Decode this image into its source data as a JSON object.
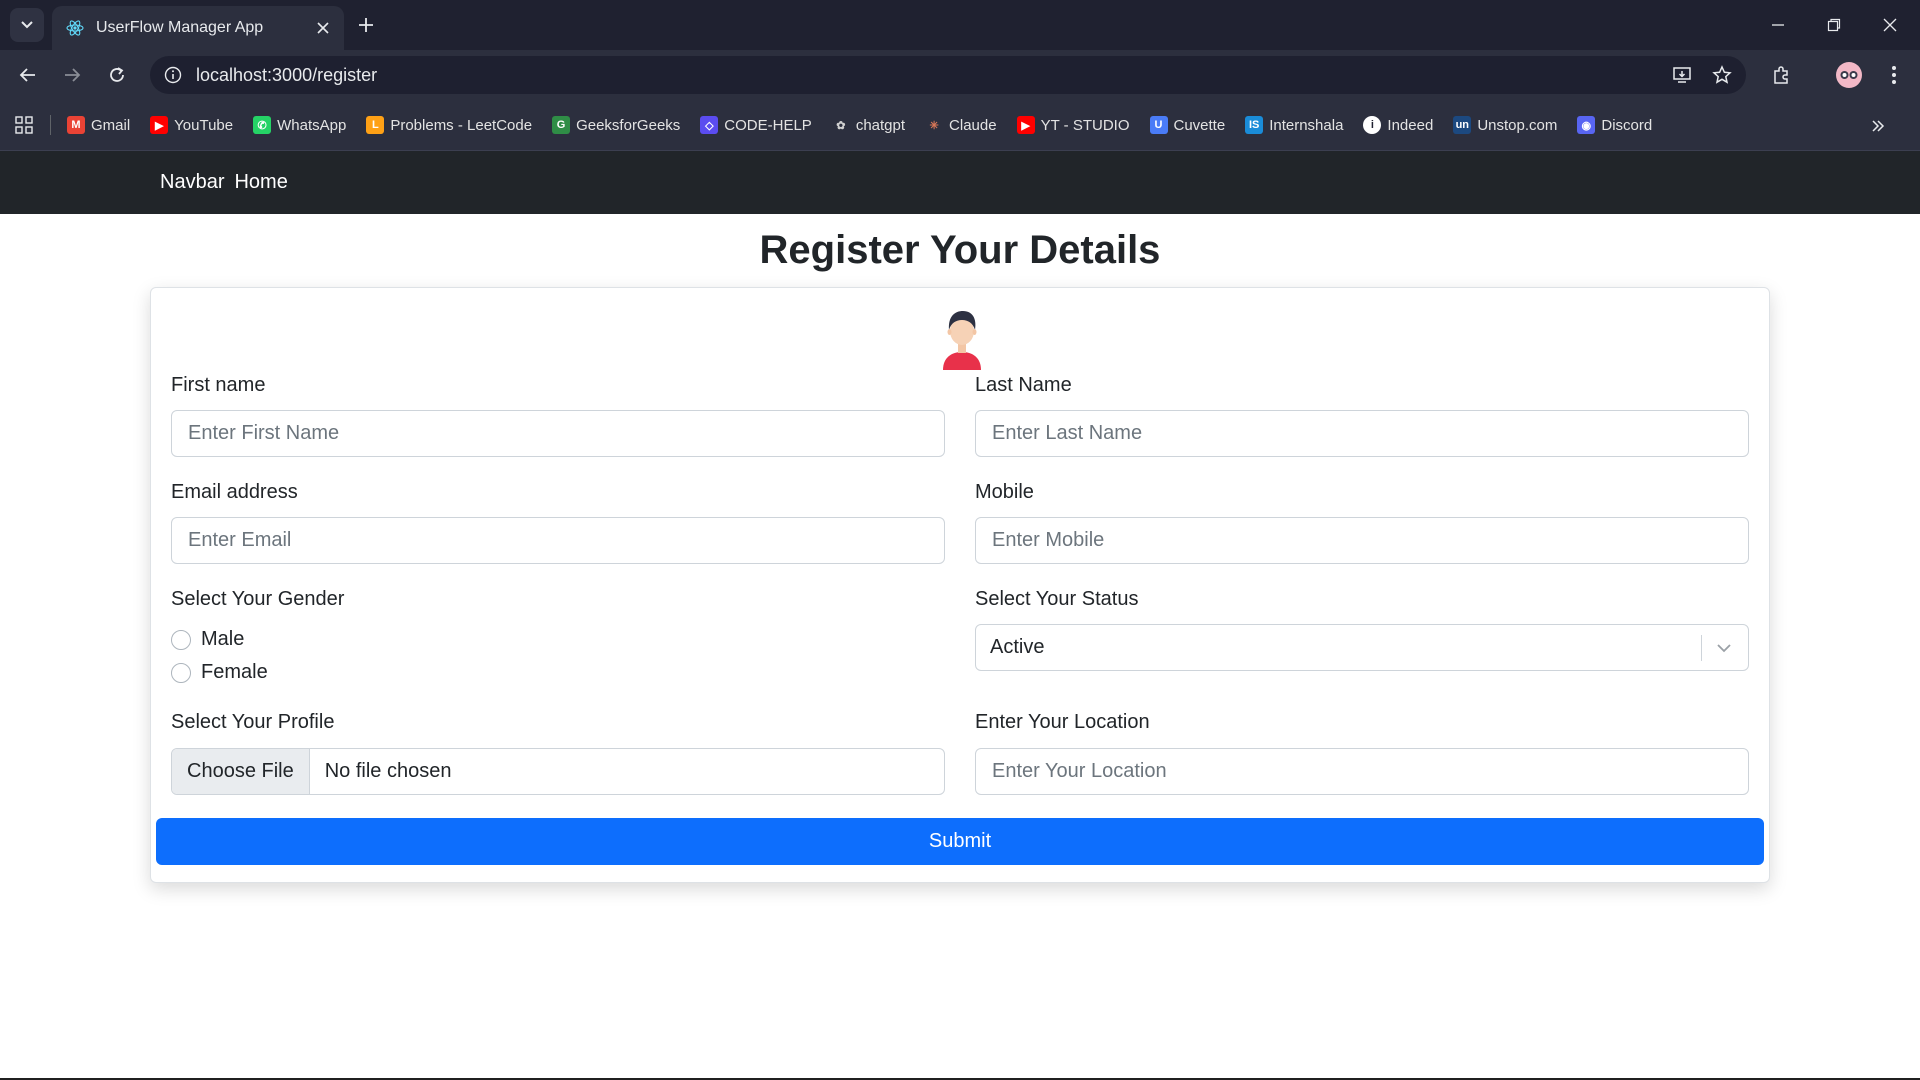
{
  "browser": {
    "tab": {
      "title": "UserFlow Manager App"
    },
    "address": {
      "url": "localhost:3000/register"
    },
    "bookmarks": [
      {
        "label": "Gmail",
        "icon": "gmail-icon",
        "color": "#ea4335"
      },
      {
        "label": "YouTube",
        "icon": "youtube-icon",
        "color": "#ff0000"
      },
      {
        "label": "WhatsApp",
        "icon": "whatsapp-icon",
        "color": "#25d366"
      },
      {
        "label": "Problems - LeetCode",
        "icon": "leetcode-icon",
        "color": "#ffa116"
      },
      {
        "label": "GeeksforGeeks",
        "icon": "geeksforgeeks-icon",
        "color": "#2f8d46"
      },
      {
        "label": "CODE-HELP",
        "icon": "codehelp-icon",
        "color": "#5b4cf0"
      },
      {
        "label": "chatgpt",
        "icon": "chatgpt-icon",
        "color": "#d0d0d0"
      },
      {
        "label": "Claude",
        "icon": "claude-icon",
        "color": "#d97757"
      },
      {
        "label": "YT - STUDIO",
        "icon": "yt-studio-icon",
        "color": "#ff0000"
      },
      {
        "label": "Cuvette",
        "icon": "cuvette-icon",
        "color": "#4a7cf7"
      },
      {
        "label": "Internshala",
        "icon": "internshala-icon",
        "color": "#1a8cd8"
      },
      {
        "label": "Indeed",
        "icon": "indeed-icon",
        "color": "#ffffff"
      },
      {
        "label": "Unstop.com",
        "icon": "unstop-icon",
        "color": "#1c4980"
      },
      {
        "label": "Discord",
        "icon": "discord-icon",
        "color": "#5865f2"
      }
    ]
  },
  "navbar": {
    "brand": "Navbar",
    "home": "Home"
  },
  "form": {
    "title": "Register Your Details",
    "first_name": {
      "label": "First name",
      "placeholder": "Enter First Name"
    },
    "last_name": {
      "label": "Last Name",
      "placeholder": "Enter Last Name"
    },
    "email": {
      "label": "Email address",
      "placeholder": "Enter Email"
    },
    "mobile": {
      "label": "Mobile",
      "placeholder": "Enter Mobile"
    },
    "gender": {
      "label": "Select Your Gender",
      "options": [
        "Male",
        "Female"
      ]
    },
    "status": {
      "label": "Select Your Status",
      "value": "Active"
    },
    "profile": {
      "label": "Select Your Profile",
      "button": "Choose File",
      "status": "No file chosen"
    },
    "location": {
      "label": "Enter Your Location",
      "placeholder": "Enter Your Location"
    },
    "submit": "Submit"
  },
  "colors": {
    "primary": "#0d6efd",
    "navbar_bg": "#212529",
    "chrome_bg": "#2c2f3e"
  }
}
